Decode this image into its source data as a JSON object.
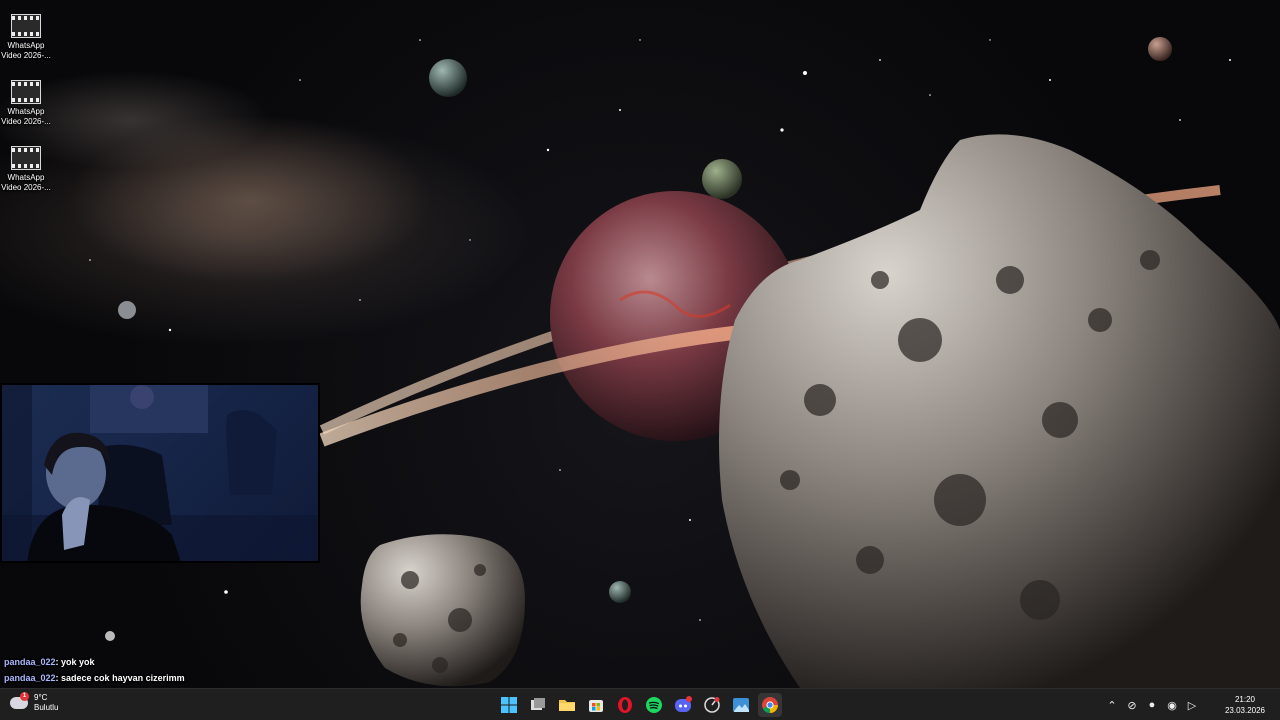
{
  "desktop": {
    "icons": [
      {
        "name": "WhatsApp",
        "subtitle": "Video 2026-..."
      },
      {
        "name": "WhatsApp",
        "subtitle": "Video 2026-..."
      },
      {
        "name": "WhatsApp",
        "subtitle": "Video 2026-..."
      }
    ]
  },
  "chat": {
    "messages": [
      {
        "user": "pandaa_022",
        "text": "yok yok"
      },
      {
        "user": "pandaa_022",
        "text": "sadece cok hayvan cizerimm"
      }
    ]
  },
  "taskbar": {
    "weather": {
      "temp": "9°C",
      "condition": "Bulutlu",
      "badge": "1",
      "icon": "cloud-icon"
    },
    "apps": [
      {
        "name": "start",
        "icon": "windows-icon",
        "active": false
      },
      {
        "name": "task-view",
        "icon": "task-view-icon",
        "active": false
      },
      {
        "name": "file-explorer",
        "icon": "folder-icon",
        "active": false
      },
      {
        "name": "microsoft-store",
        "icon": "store-icon",
        "active": false
      },
      {
        "name": "opera",
        "icon": "opera-icon",
        "active": false
      },
      {
        "name": "spotify",
        "icon": "spotify-icon",
        "active": false
      },
      {
        "name": "discord",
        "icon": "discord-icon",
        "active": false,
        "badge": "9+"
      },
      {
        "name": "clock-app",
        "icon": "dial-icon",
        "active": false
      },
      {
        "name": "photos",
        "icon": "photos-icon",
        "active": false
      },
      {
        "name": "chrome",
        "icon": "chrome-icon",
        "active": true
      }
    ],
    "tray": {
      "icons": [
        "chevron-up-icon",
        "network-off-icon",
        "microphone-icon",
        "wifi-icon",
        "volume-icon"
      ],
      "time": "21:20",
      "date": "23.03.2026"
    }
  },
  "colors": {
    "taskbar_bg": "#1f1f1f",
    "chat_username": "#aab7ff",
    "discord_badge": "#e4343a"
  }
}
